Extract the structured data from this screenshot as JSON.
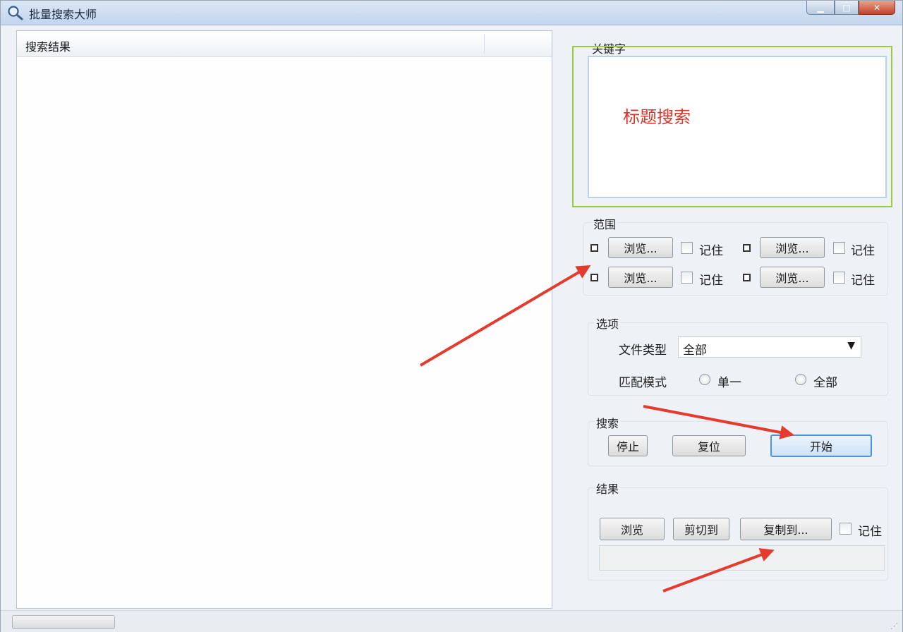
{
  "window": {
    "title": "批量搜索大师"
  },
  "results_list": {
    "header": "搜索结果"
  },
  "keyword": {
    "group_label": "关键字",
    "value": "标题搜索"
  },
  "range": {
    "group_label": "范围",
    "rows": [
      {
        "browse_label": "浏览...",
        "remember_label": "记住"
      },
      {
        "browse_label": "浏览...",
        "remember_label": "记住"
      },
      {
        "browse_label": "浏览...",
        "remember_label": "记住"
      },
      {
        "browse_label": "浏览...",
        "remember_label": "记住"
      }
    ]
  },
  "options": {
    "group_label": "选项",
    "file_type_label": "文件类型",
    "file_type_value": "全部",
    "match_mode_label": "匹配模式",
    "match_single": "单一",
    "match_all": "全部"
  },
  "search": {
    "group_label": "搜索",
    "stop": "停止",
    "reset": "复位",
    "start": "开始"
  },
  "result": {
    "group_label": "结果",
    "browse": "浏览",
    "cut_to": "剪切到",
    "copy_to": "复制到...",
    "remember": "记住"
  },
  "annotation_color": "#e53a2e"
}
